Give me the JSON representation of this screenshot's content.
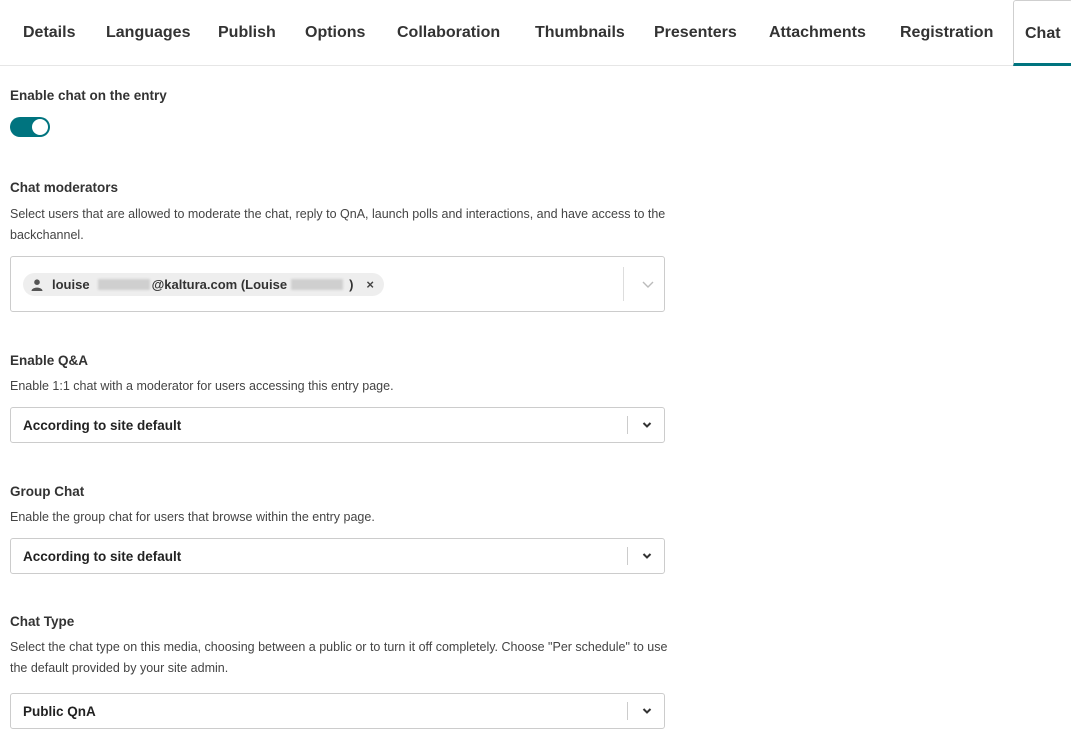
{
  "tabs": [
    {
      "label": "Details"
    },
    {
      "label": "Languages"
    },
    {
      "label": "Publish"
    },
    {
      "label": "Options"
    },
    {
      "label": "Collaboration"
    },
    {
      "label": "Thumbnails"
    },
    {
      "label": "Presenters"
    },
    {
      "label": "Attachments"
    },
    {
      "label": "Registration"
    },
    {
      "label": "Chat",
      "active": true
    }
  ],
  "enable_chat": {
    "label": "Enable chat on the entry",
    "enabled": true
  },
  "moderators": {
    "label": "Chat moderators",
    "description": "Select users that are allowed to moderate the chat, reply to QnA, launch polls and interactions, and have access to the backchannel.",
    "chip": {
      "prefix": "louise",
      "middle": "@kaltura.com (Louise",
      "suffix": ")",
      "remove": "×"
    }
  },
  "qna": {
    "label": "Enable Q&A",
    "description": "Enable 1:1 chat with a moderator for users accessing this entry page.",
    "value": "According to site default"
  },
  "group_chat": {
    "label": "Group Chat",
    "description": "Enable the group chat for users that browse within the entry page.",
    "value": "According to site default"
  },
  "chat_type": {
    "label": "Chat Type",
    "description": "Select the chat type on this media, choosing between a public or to turn it off completely. Choose \"Per schedule\" to use the default provided by your site admin.",
    "value": "Public QnA"
  },
  "colors": {
    "accent": "#00747f"
  }
}
